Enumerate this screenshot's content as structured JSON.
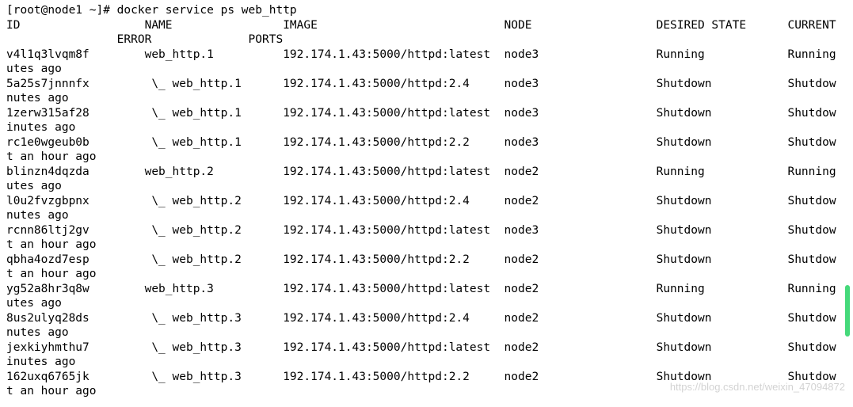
{
  "prompt": "[root@node1 ~]# ",
  "command": "docker service ps web_http",
  "headers": {
    "id": "ID",
    "name": "NAME",
    "image": "IMAGE",
    "node": "NODE",
    "desired": "DESIRED STATE",
    "current": "CURRENT",
    "error": "ERROR",
    "ports": "PORTS"
  },
  "rows": [
    {
      "id": "v4l1q3lvqm8f",
      "name": "web_http.1",
      "image": "192.174.1.43:5000/httpd:latest",
      "node": "node3",
      "desired": "Running",
      "current": "Running",
      "wrap": "utes ago"
    },
    {
      "id": "5a25s7jnnnfx",
      "name": " \\_ web_http.1",
      "image": "192.174.1.43:5000/httpd:2.4",
      "node": "node3",
      "desired": "Shutdown",
      "current": "Shutdow",
      "wrap": "nutes ago"
    },
    {
      "id": "1zerw315af28",
      "name": " \\_ web_http.1",
      "image": "192.174.1.43:5000/httpd:latest",
      "node": "node3",
      "desired": "Shutdown",
      "current": "Shutdow",
      "wrap": "inutes ago"
    },
    {
      "id": "rc1e0wgeub0b",
      "name": " \\_ web_http.1",
      "image": "192.174.1.43:5000/httpd:2.2",
      "node": "node3",
      "desired": "Shutdown",
      "current": "Shutdow",
      "wrap": "t an hour ago"
    },
    {
      "id": "blinzn4dqzda",
      "name": "web_http.2",
      "image": "192.174.1.43:5000/httpd:latest",
      "node": "node2",
      "desired": "Running",
      "current": "Running",
      "wrap": "utes ago"
    },
    {
      "id": "l0u2fvzgbpnx",
      "name": " \\_ web_http.2",
      "image": "192.174.1.43:5000/httpd:2.4",
      "node": "node2",
      "desired": "Shutdown",
      "current": "Shutdow",
      "wrap": "nutes ago"
    },
    {
      "id": "rcnn86ltj2gv",
      "name": " \\_ web_http.2",
      "image": "192.174.1.43:5000/httpd:latest",
      "node": "node3",
      "desired": "Shutdown",
      "current": "Shutdow",
      "wrap": "t an hour ago"
    },
    {
      "id": "qbha4ozd7esp",
      "name": " \\_ web_http.2",
      "image": "192.174.1.43:5000/httpd:2.2",
      "node": "node2",
      "desired": "Shutdown",
      "current": "Shutdow",
      "wrap": "t an hour ago"
    },
    {
      "id": "yg52a8hr3q8w",
      "name": "web_http.3",
      "image": "192.174.1.43:5000/httpd:latest",
      "node": "node2",
      "desired": "Running",
      "current": "Running",
      "wrap": "utes ago"
    },
    {
      "id": "8us2ulyq28ds",
      "name": " \\_ web_http.3",
      "image": "192.174.1.43:5000/httpd:2.4",
      "node": "node2",
      "desired": "Shutdown",
      "current": "Shutdow",
      "wrap": "nutes ago"
    },
    {
      "id": "jexkiyhmthu7",
      "name": " \\_ web_http.3",
      "image": "192.174.1.43:5000/httpd:latest",
      "node": "node2",
      "desired": "Shutdown",
      "current": "Shutdow",
      "wrap": "inutes ago"
    },
    {
      "id": "162uxq6765jk",
      "name": " \\_ web_http.3",
      "image": "192.174.1.43:5000/httpd:2.2",
      "node": "node2",
      "desired": "Shutdown",
      "current": "Shutdow",
      "wrap": "t an hour ago"
    }
  ],
  "watermark": "https://blog.csdn.net/weixin_47094872"
}
